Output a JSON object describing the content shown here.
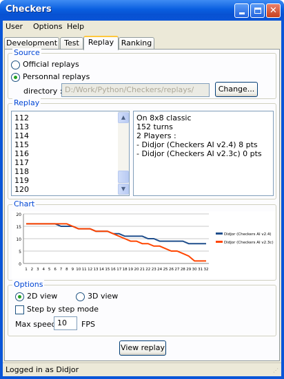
{
  "window": {
    "title": "Checkers"
  },
  "menu": [
    "User",
    "Options",
    "Help"
  ],
  "tabs": [
    {
      "label": "Development"
    },
    {
      "label": "Test"
    },
    {
      "label": "Replay"
    },
    {
      "label": "Ranking"
    }
  ],
  "source": {
    "legend": "Source",
    "official_label": "Official replays",
    "personal_label": "Personnal replays",
    "selected": "personal",
    "directory_label": "directory :",
    "directory_value": "D:/Work/Python/Checkers/replays/",
    "change_label": "Change..."
  },
  "replay": {
    "legend": "Replay",
    "items": [
      "112",
      "113",
      "114",
      "115",
      "116",
      "117",
      "118",
      "119",
      "120"
    ],
    "info": [
      "On 8x8 classic",
      "152 turns",
      "2 Players :",
      "- Didjor (Checkers AI v2.4) 8 pts",
      "- Didjor (Checkers AI v2.3c) 0 pts"
    ]
  },
  "chart_panel": {
    "legend": "Chart"
  },
  "chart_data": {
    "type": "line",
    "x": [
      1,
      2,
      3,
      4,
      5,
      6,
      7,
      8,
      9,
      10,
      11,
      12,
      13,
      14,
      15,
      16,
      17,
      18,
      19,
      20,
      21,
      22,
      23,
      24,
      25,
      26,
      27,
      28,
      29,
      30,
      31,
      32
    ],
    "x_tick_labels": [
      "1",
      "2",
      "3",
      "4",
      "5",
      "6",
      "7",
      "8",
      "9",
      "10",
      "11",
      "12",
      "13",
      "14",
      "15",
      "16",
      "17",
      "18",
      "19",
      "20",
      "21",
      "22",
      "23",
      "24",
      "25",
      "26",
      "27",
      "28",
      "29",
      "30",
      "31",
      "32"
    ],
    "y_ticks": [
      "0",
      "5",
      "10",
      "15",
      "20"
    ],
    "ylim": [
      0,
      20
    ],
    "grid": true,
    "legend_position": "right",
    "series": [
      {
        "name": "Didjor (Checkers AI v2.4)",
        "color": "#1f4e8c",
        "values": [
          16,
          16,
          16,
          16,
          16,
          16,
          15,
          15,
          15,
          14,
          14,
          14,
          13,
          13,
          13,
          12,
          12,
          11,
          11,
          11,
          11,
          10,
          10,
          9,
          9,
          9,
          9,
          9,
          8,
          8,
          8,
          8
        ]
      },
      {
        "name": "Didjor (Checkers AI v2.3c)",
        "color": "#ff4500",
        "values": [
          16,
          16,
          16,
          16,
          16,
          16,
          16,
          16,
          15,
          14,
          14,
          14,
          13,
          13,
          13,
          12,
          11,
          10,
          9,
          9,
          8,
          8,
          7,
          7,
          6,
          5,
          5,
          4,
          3,
          1,
          1,
          1
        ]
      }
    ]
  },
  "options": {
    "legend": "Options",
    "view_2d_label": "2D view",
    "view_3d_label": "3D view",
    "selected_view": "2D",
    "step_label": "Step by step mode",
    "speed_label": "Max speed",
    "speed_value": "10",
    "fps_label": "FPS"
  },
  "view_replay_label": "View replay",
  "status": "Logged in as Didjor"
}
